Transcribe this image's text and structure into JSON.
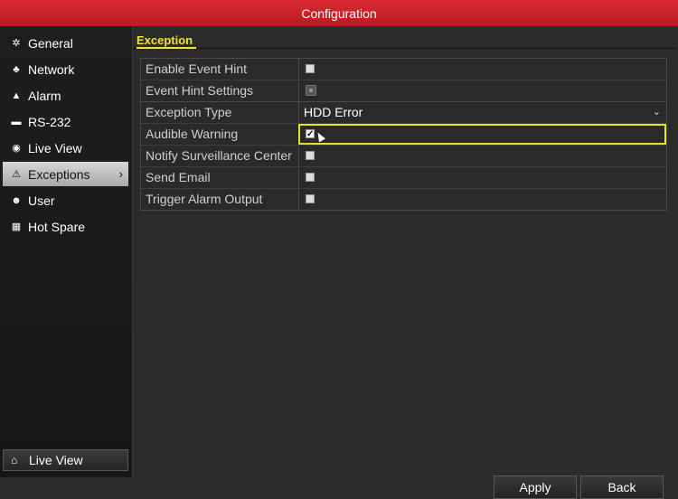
{
  "window": {
    "title": "Configuration"
  },
  "sidebar": {
    "items": [
      {
        "label": "General",
        "icon": "gear-icon",
        "glyph": "✲"
      },
      {
        "label": "Network",
        "icon": "network-icon",
        "glyph": "♣"
      },
      {
        "label": "Alarm",
        "icon": "alarm-icon",
        "glyph": "▲"
      },
      {
        "label": "RS-232",
        "icon": "serial-port-icon",
        "glyph": "▬"
      },
      {
        "label": "Live View",
        "icon": "eye-icon",
        "glyph": "◉"
      },
      {
        "label": "Exceptions",
        "icon": "warning-icon",
        "glyph": "⚠",
        "active": true
      },
      {
        "label": "User",
        "icon": "user-icon",
        "glyph": "☻"
      },
      {
        "label": "Hot Spare",
        "icon": "hot-spare-icon",
        "glyph": "▦"
      }
    ],
    "live_view_button": "Live View",
    "live_view_glyph": "⌂"
  },
  "section": {
    "tab": "Exception"
  },
  "group1": {
    "enable_event_hint": {
      "label": "Enable Event Hint",
      "checked": false
    },
    "event_hint_settings": {
      "label": "Event Hint Settings"
    }
  },
  "group2": {
    "exception_type": {
      "label": "Exception Type",
      "value": "HDD Error"
    },
    "audible_warning": {
      "label": "Audible Warning",
      "checked": true
    },
    "notify_surveillance_center": {
      "label": "Notify Surveillance Center",
      "checked": false
    },
    "send_email": {
      "label": "Send Email",
      "checked": false
    },
    "trigger_alarm_output": {
      "label": "Trigger Alarm Output",
      "checked": false
    }
  },
  "footer": {
    "apply": "Apply",
    "back": "Back"
  },
  "colors": {
    "title_bar": "#c8222a",
    "focus_outline": "#e6e02c",
    "tab_accent": "#f2e233"
  }
}
